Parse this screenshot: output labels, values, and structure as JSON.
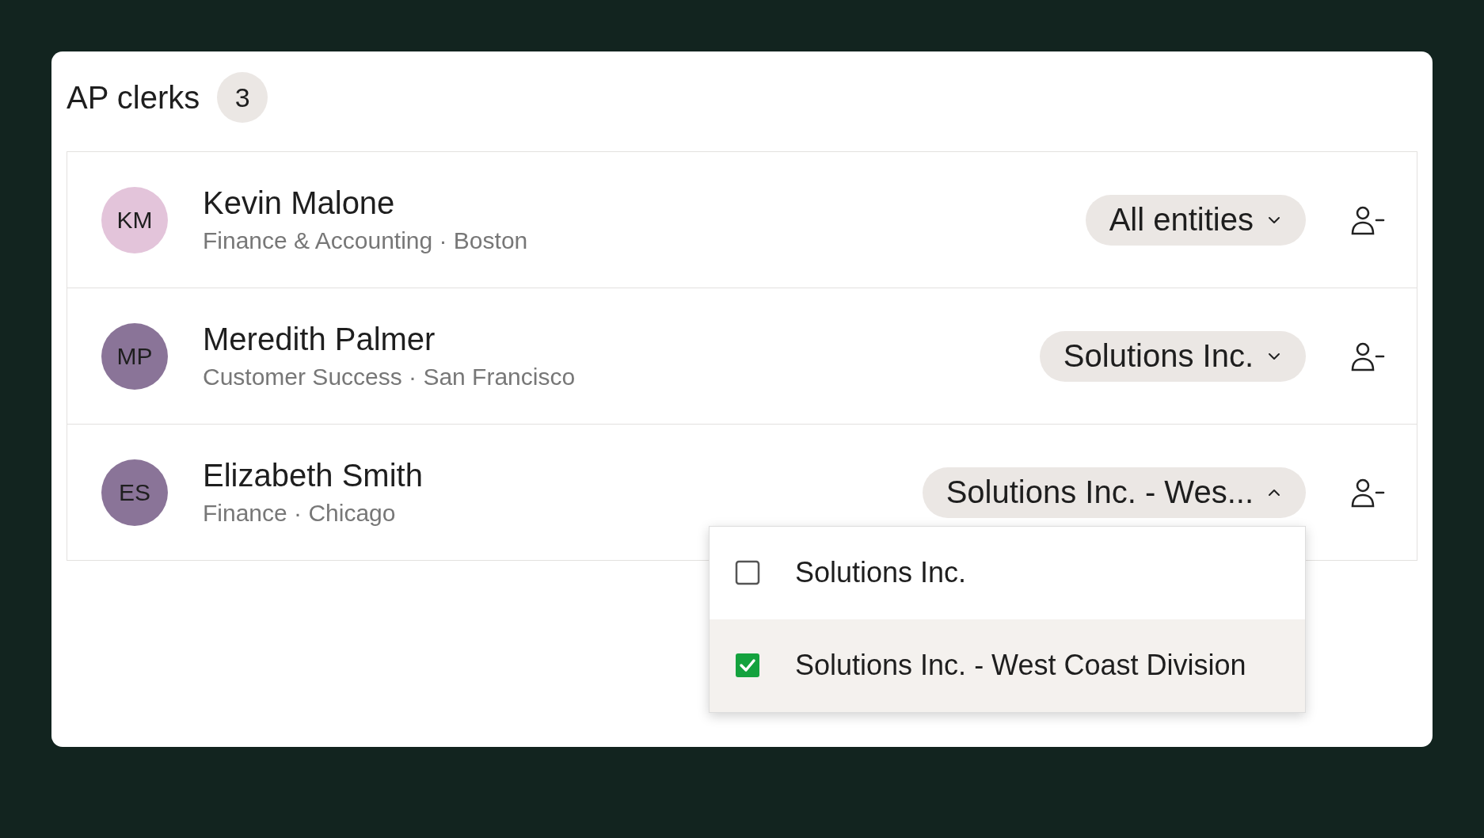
{
  "title": "AP clerks",
  "count": "3",
  "clerks": [
    {
      "initials": "KM",
      "color": "#e3c4da",
      "name": "Kevin Malone",
      "subtitle": "Finance & Accounting · Boston",
      "entity": "All entities",
      "expanded": false
    },
    {
      "initials": "MP",
      "color": "#8a7498",
      "name": "Meredith Palmer",
      "subtitle": "Customer Success · San Francisco",
      "entity": "Solutions Inc.",
      "expanded": false
    },
    {
      "initials": "ES",
      "color": "#8a7498",
      "name": "Elizabeth Smith",
      "subtitle": "Finance · Chicago",
      "entity": "Solutions Inc. - Wes...",
      "expanded": true
    }
  ],
  "dropdown": {
    "options": [
      {
        "label": "Solutions Inc.",
        "checked": false,
        "selected": false
      },
      {
        "label": "Solutions Inc. - West Coast Division",
        "checked": true,
        "selected": true
      }
    ]
  }
}
